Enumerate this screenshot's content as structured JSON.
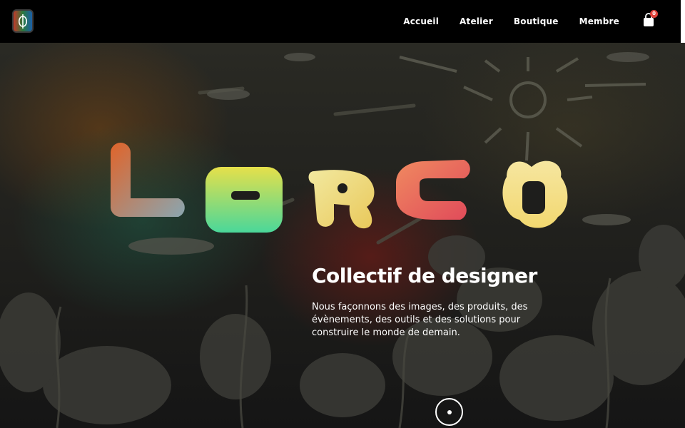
{
  "header": {
    "nav": [
      {
        "label": "Accueil"
      },
      {
        "label": "Atelier"
      },
      {
        "label": "Boutique"
      },
      {
        "label": "Membre"
      }
    ],
    "cart": {
      "icon": "shopping-bag-icon",
      "count": "0"
    }
  },
  "hero": {
    "brand": "LORCO",
    "tagline": "Collectif de designer",
    "description": "Nous façonnons des images, des produits, des évènements, des outils et des solutions pour construire le monde de demain."
  },
  "colors": {
    "header_bg": "#000000",
    "badge": "#e0423a",
    "accent_orange": "#e0642a",
    "accent_green": "#54d98a",
    "accent_yellow": "#f0e27a"
  }
}
